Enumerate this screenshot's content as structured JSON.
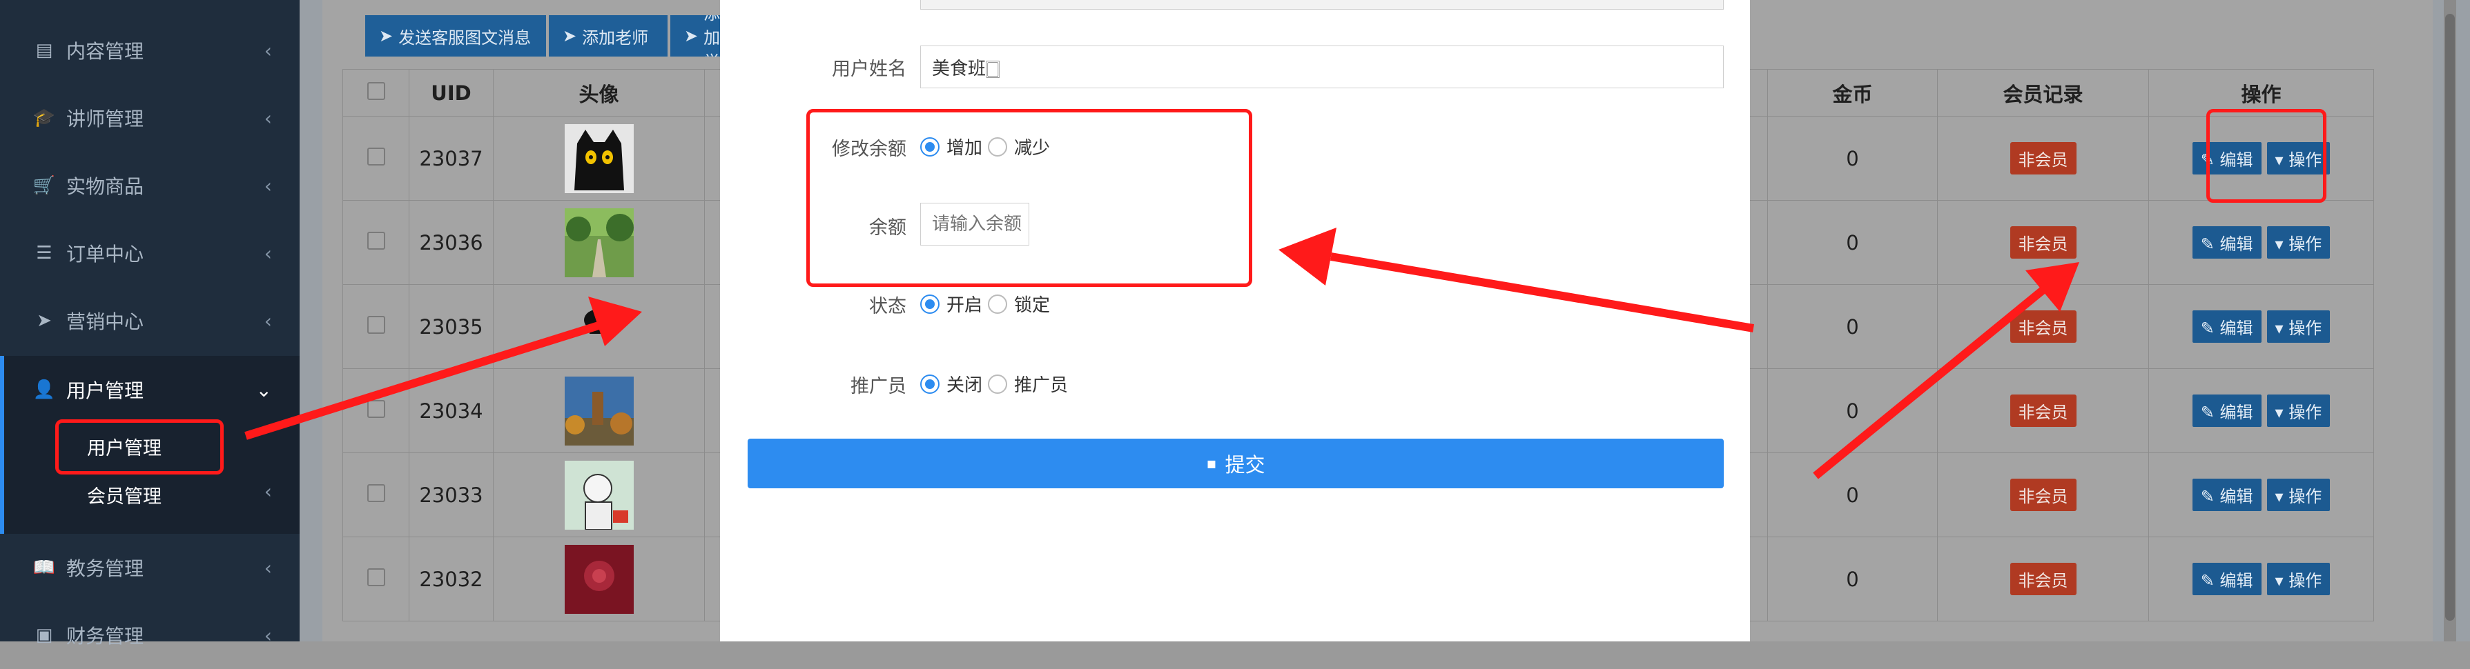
{
  "sidebar": {
    "items": [
      {
        "label": "内容管理",
        "icon": "newspaper-icon",
        "glyph": "▤"
      },
      {
        "label": "讲师管理",
        "icon": "graduation-cap-icon",
        "glyph": "🎓"
      },
      {
        "label": "实物商品",
        "icon": "cart-icon",
        "glyph": "🛒"
      },
      {
        "label": "订单中心",
        "icon": "list-icon",
        "glyph": "☰"
      },
      {
        "label": "营销中心",
        "icon": "paper-plane-icon",
        "glyph": "➤"
      },
      {
        "label": "用户管理",
        "icon": "user-icon",
        "glyph": "👤"
      },
      {
        "label": "教务管理",
        "icon": "book-icon",
        "glyph": "📖"
      },
      {
        "label": "财务管理",
        "icon": "money-icon",
        "glyph": "▣"
      }
    ],
    "sub_items": [
      {
        "label": "用户管理"
      },
      {
        "label": "会员管理"
      }
    ]
  },
  "toolbar": {
    "send_news": "发送客服图文消息",
    "add_teacher": "添加老师",
    "add_student_partial": "添加学"
  },
  "table": {
    "headers": {
      "uid": "UID",
      "avatar": "头像",
      "coins": "金币",
      "member": "会员记录",
      "ops": "操作"
    },
    "rows": [
      {
        "uid": "23037",
        "coins": "0",
        "member": "非会员"
      },
      {
        "uid": "23036",
        "coins": "0",
        "member": "非会员"
      },
      {
        "uid": "23035",
        "coins": "0",
        "member": "非会员"
      },
      {
        "uid": "23034",
        "coins": "0",
        "member": "非会员"
      },
      {
        "uid": "23033",
        "coins": "0",
        "member": "非会员"
      },
      {
        "uid": "23032",
        "coins": "0",
        "member": "非会员"
      }
    ],
    "edit_label": "编辑",
    "op_label": "操作"
  },
  "modal": {
    "name_label": "用户姓名",
    "name_value": "美食班🀆",
    "balance_mode_label": "修改余额",
    "balance_add": "增加",
    "balance_sub": "减少",
    "balance_label": "余额",
    "balance_placeholder": "请输入余额",
    "status_label": "状态",
    "status_on": "开启",
    "status_lock": "锁定",
    "promoter_label": "推广员",
    "promoter_off": "关闭",
    "promoter_on": "推广员",
    "submit_label": "提交"
  },
  "colors": {
    "sidebar_bg": "#1f2d3d",
    "accent": "#2d8cf0",
    "annotation_red": "#ff1a1a",
    "badge_red": "#b03a22"
  }
}
